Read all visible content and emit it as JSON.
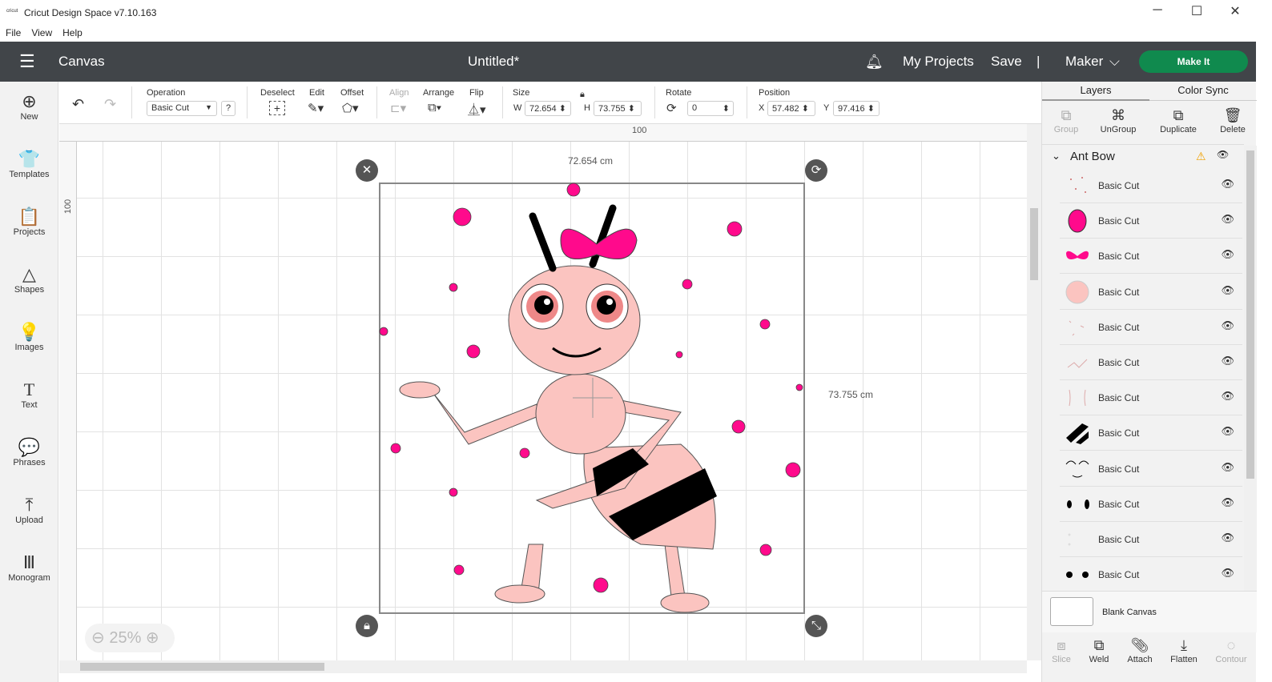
{
  "window": {
    "title": "Cricut Design Space  v7.10.163",
    "logo": "cricut",
    "minimize": "─",
    "maximize": "☐",
    "close": "✕"
  },
  "menu": [
    "File",
    "View",
    "Help"
  ],
  "header": {
    "section": "Canvas",
    "doc_title": "Untitled*",
    "my_projects": "My Projects",
    "save": "Save",
    "divider": "|",
    "machine": "Maker",
    "make_it": "Make It"
  },
  "sidebar": [
    {
      "label": "New",
      "icon": "⊕"
    },
    {
      "label": "Templates",
      "icon": "👕"
    },
    {
      "label": "Projects",
      "icon": "📋"
    },
    {
      "label": "Shapes",
      "icon": "△"
    },
    {
      "label": "Images",
      "icon": "💡"
    },
    {
      "label": "Text",
      "icon": "T"
    },
    {
      "label": "Phrases",
      "icon": "💬"
    },
    {
      "label": "Upload",
      "icon": "⤒"
    },
    {
      "label": "Monogram",
      "icon": "Ⅲ"
    }
  ],
  "toolbar": {
    "operation_label": "Operation",
    "operation_value": "Basic Cut",
    "help": "?",
    "deselect": "Deselect",
    "edit": "Edit",
    "offset": "Offset",
    "align": "Align",
    "arrange": "Arrange",
    "flip": "Flip",
    "size": "Size",
    "w_label": "W",
    "w": "72.654",
    "h_label": "H",
    "h": "73.755",
    "rotate": "Rotate",
    "rotate_value": "0",
    "position": "Position",
    "x_label": "X",
    "x": "57.482",
    "y_label": "Y",
    "y": "97.416"
  },
  "canvas": {
    "ruler_top": "100",
    "ruler_left": "100",
    "width_dim": "72.654 cm",
    "height_dim": "73.755 cm",
    "zoom": "25%"
  },
  "panel": {
    "tabs": [
      "Layers",
      "Color Sync"
    ],
    "actions": [
      "Group",
      "UnGroup",
      "Duplicate",
      "Delete"
    ],
    "group_name": "Ant Bow",
    "layers": [
      "Basic Cut",
      "Basic Cut",
      "Basic Cut",
      "Basic Cut",
      "Basic Cut",
      "Basic Cut",
      "Basic Cut",
      "Basic Cut",
      "Basic Cut",
      "Basic Cut",
      "Basic Cut",
      "Basic Cut"
    ],
    "blank_canvas": "Blank Canvas",
    "bottom_actions": [
      "Slice",
      "Weld",
      "Attach",
      "Flatten",
      "Contour"
    ]
  },
  "colors": {
    "header": "#414549",
    "make_it": "#108a4e",
    "pink": "#ff0a8c",
    "skin": "#fbc4c0"
  }
}
